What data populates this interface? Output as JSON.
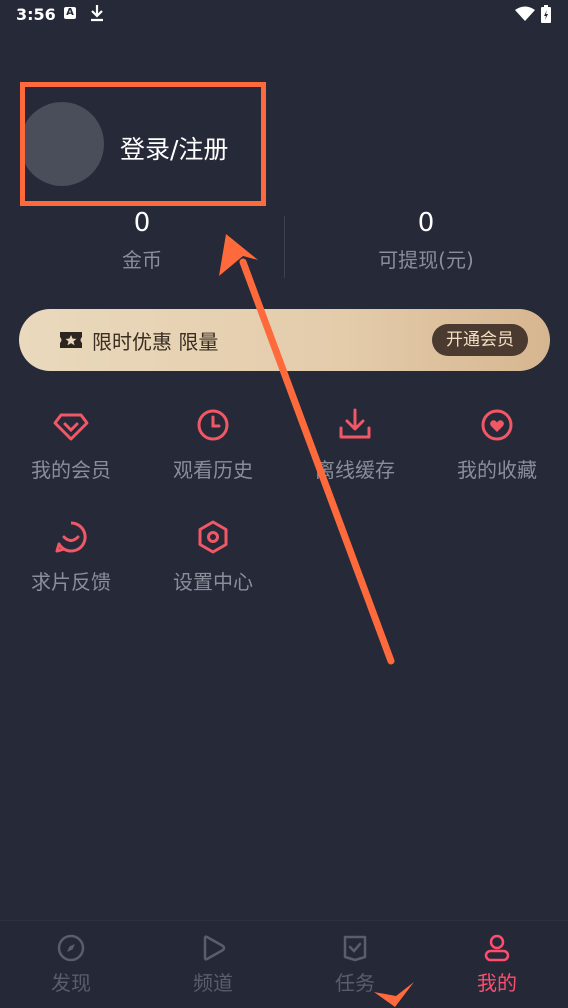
{
  "status_bar": {
    "time": "3:56",
    "badge": "A"
  },
  "profile": {
    "login_label": "登录/注册"
  },
  "stats": [
    {
      "value": "0",
      "label": "金币"
    },
    {
      "value": "0",
      "label": "可提现(元)"
    }
  ],
  "vip_banner": {
    "text": "限时优惠 限量",
    "button": "开通会员"
  },
  "grid": [
    {
      "label": "我的会员",
      "icon": "diamond-icon"
    },
    {
      "label": "观看历史",
      "icon": "clock-icon"
    },
    {
      "label": "离线缓存",
      "icon": "download-icon"
    },
    {
      "label": "我的收藏",
      "icon": "heart-icon"
    },
    {
      "label": "求片反馈",
      "icon": "chat-smile-icon"
    },
    {
      "label": "设置中心",
      "icon": "hexagon-settings-icon"
    }
  ],
  "tabs": [
    {
      "label": "发现",
      "icon": "compass-icon"
    },
    {
      "label": "频道",
      "icon": "play-icon"
    },
    {
      "label": "任务",
      "icon": "task-icon"
    },
    {
      "label": "我的",
      "icon": "user-icon",
      "active": true
    }
  ],
  "colors": {
    "accent": "#ff4d6d",
    "icon": "#f25766",
    "background": "#252938",
    "annotation": "#ff6a3d"
  }
}
